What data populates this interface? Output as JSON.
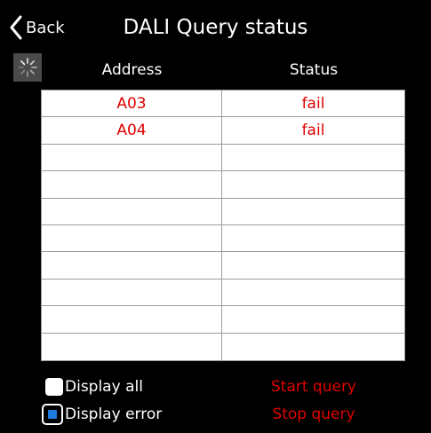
{
  "header": {
    "back_label": "Back",
    "title": "DALI Query status"
  },
  "table": {
    "columns": [
      "Address",
      "Status"
    ],
    "rows": [
      {
        "address": "A03",
        "status": "fail"
      },
      {
        "address": "A04",
        "status": "fail"
      },
      {
        "address": "",
        "status": ""
      },
      {
        "address": "",
        "status": ""
      },
      {
        "address": "",
        "status": ""
      },
      {
        "address": "",
        "status": ""
      },
      {
        "address": "",
        "status": ""
      },
      {
        "address": "",
        "status": ""
      },
      {
        "address": "",
        "status": ""
      },
      {
        "address": "",
        "status": ""
      }
    ]
  },
  "filters": {
    "display_all": {
      "label": "Display all",
      "checked": false
    },
    "display_error": {
      "label": "Display error",
      "checked": true
    }
  },
  "actions": {
    "start_query": "Start query",
    "stop_query": "Stop query"
  },
  "colors": {
    "background": "#000000",
    "accent_red": "#e00000",
    "checkbox_blue": "#1e7be0",
    "spinner_bg": "#4a4a4a"
  },
  "icons": {
    "back": "chevron-left-icon",
    "loading": "spinner-icon"
  }
}
